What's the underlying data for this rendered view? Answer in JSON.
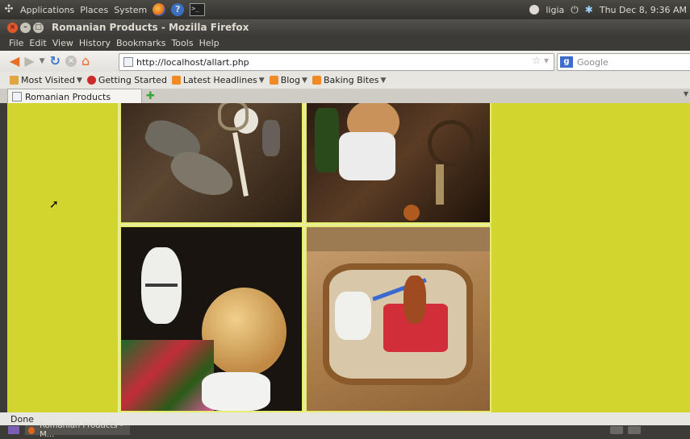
{
  "top_panel": {
    "applications": "Applications",
    "places": "Places",
    "system": "System",
    "user": "ligia",
    "clock": "Thu Dec  8,  9:36 AM"
  },
  "window": {
    "title": "Romanian Products - Mozilla Firefox"
  },
  "menu": [
    "File",
    "Edit",
    "View",
    "History",
    "Bookmarks",
    "Tools",
    "Help"
  ],
  "nav": {
    "url": "http://localhost/allart.php",
    "search_placeholder": "Google"
  },
  "bookmarks": [
    {
      "label": "Most Visited",
      "icon": "folder-icon"
    },
    {
      "label": "Getting Started",
      "icon": "firefox-icon"
    },
    {
      "label": "Latest Headlines",
      "icon": "rss-icon"
    },
    {
      "label": "Blog",
      "icon": "rss-icon"
    },
    {
      "label": "Baking Bites",
      "icon": "rss-icon"
    }
  ],
  "tab": {
    "label": "Romanian Products"
  },
  "status": {
    "text": "Done"
  },
  "taskbar": {
    "window_label": "Romanian Products - M..."
  },
  "colors": {
    "page_background": "#d2d52e",
    "photo_border": "#e6ee70",
    "panel": "#3c3b37"
  }
}
